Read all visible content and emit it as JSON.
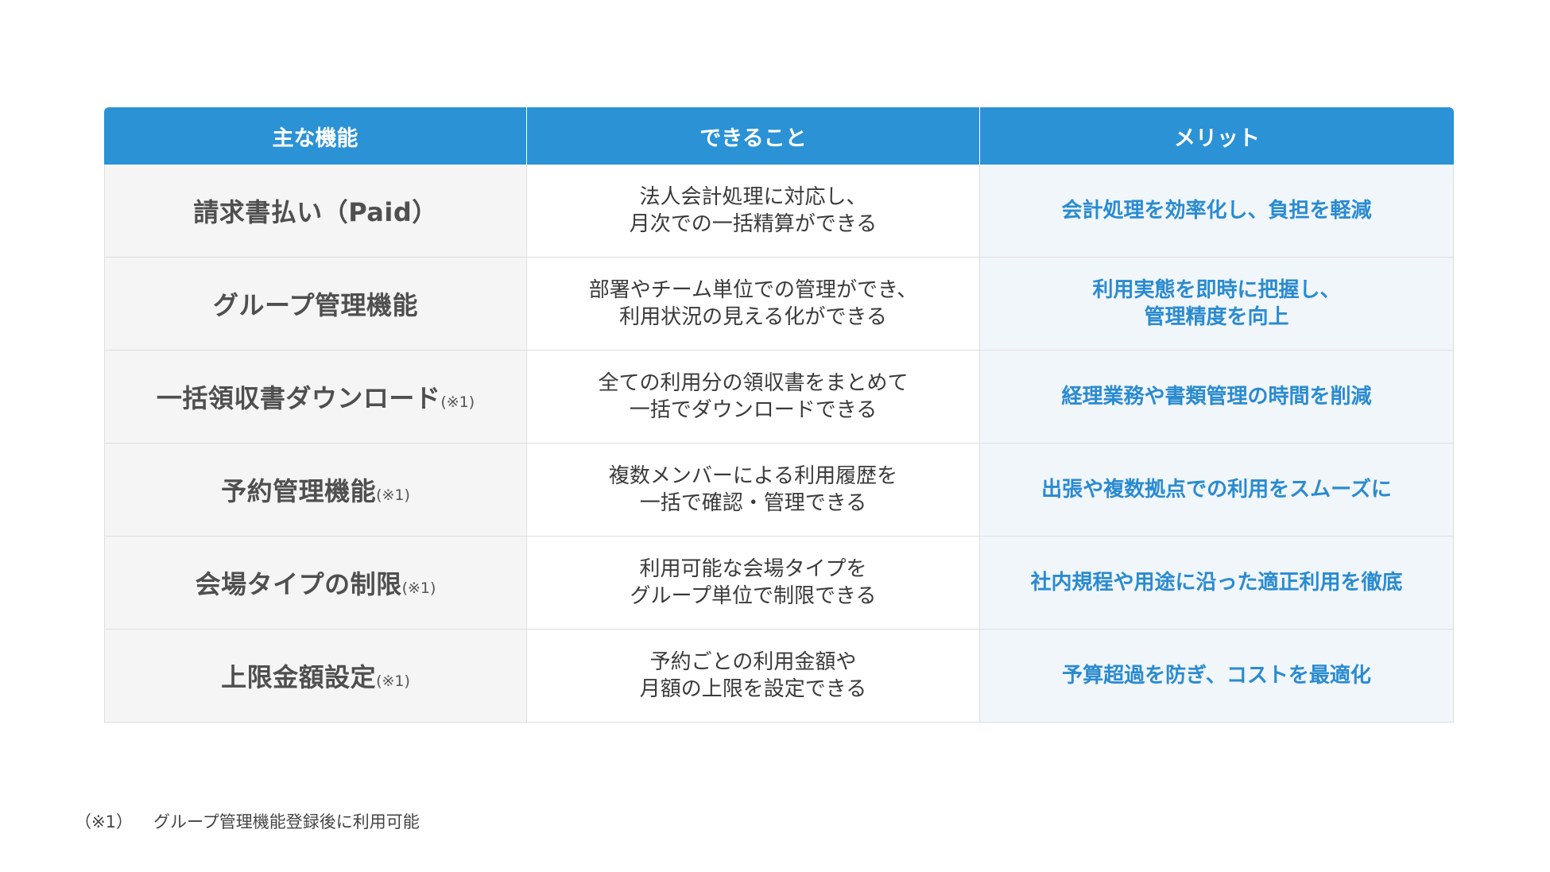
{
  "table": {
    "headers": [
      "主な機能",
      "できること",
      "メリット"
    ],
    "rows": [
      {
        "feature": "請求書払い（Paid）",
        "note": "",
        "description": "法人会計処理に対応し、\n月次での一括精算ができる",
        "merit": "会計処理を効率化し、負担を軽減"
      },
      {
        "feature": "グループ管理機能",
        "note": "",
        "description": "部署やチーム単位での管理ができ、\n利用状況の見える化ができる",
        "merit": "利用実態を即時に把握し、\n管理精度を向上"
      },
      {
        "feature": "一括領収書ダウンロード",
        "note": "(※1)",
        "description": "全ての利用分の領収書をまとめて\n一括でダウンロードできる",
        "merit": "経理業務や書類管理の時間を削減"
      },
      {
        "feature": "予約管理機能",
        "note": "(※1)",
        "description": "複数メンバーによる利用履歴を\n一括で確認・管理できる",
        "merit": "出張や複数拠点での利用をスムーズに"
      },
      {
        "feature": "会場タイプの制限",
        "note": "(※1)",
        "description": "利用可能な会場タイプを\nグループ単位で制限できる",
        "merit": "社内規程や用途に沿った適正利用を徹底"
      },
      {
        "feature": "上限金額設定",
        "note": "(※1)",
        "description": "予約ごとの利用金額や\n月額の上限を設定できる",
        "merit": "予算超過を防ぎ、コストを最適化"
      }
    ]
  },
  "footnote": {
    "mark": "（※1）",
    "text": "グループ管理機能登録後に利用可能"
  },
  "colors": {
    "header_bg": "#2b92d6",
    "merit_text": "#2a8bd0",
    "feature_bg": "#f5f5f5",
    "merit_bg": "#f1f6fb"
  }
}
